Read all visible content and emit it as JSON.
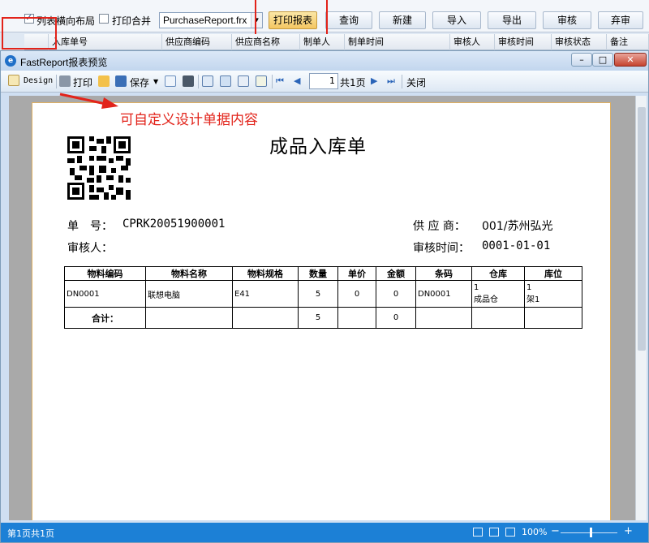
{
  "app_toolbar": {
    "checkbox_layout_label": "列表横向布局",
    "checkbox_layout_checked": true,
    "checkbox_merge_label": "打印合并",
    "checkbox_merge_checked": false,
    "report_file": "PurchaseReport.frx",
    "buttons": [
      "打印报表",
      "查询",
      "新建",
      "导入",
      "导出",
      "审核",
      "弃审"
    ]
  },
  "grid_columns": [
    "入库单号",
    "供应商编码",
    "供应商名称",
    "制单人",
    "制单时间",
    "审核人",
    "审核时间",
    "审核状态",
    "备注"
  ],
  "preview_window": {
    "title": "FastReport报表预览",
    "toolbar": {
      "design_label": "Design",
      "print_label": "打印",
      "save_label": "保存",
      "page_number": "1",
      "page_total": "共1页",
      "close_label": "关闭"
    },
    "annotation": "可自定义设计单据内容",
    "report": {
      "title": "成品入库单",
      "doc_no_label": "单　号：",
      "doc_no": "CPRK20051900001",
      "reviewer_label": "审核人：",
      "reviewer": "",
      "supplier_label": "供 应 商：",
      "supplier": "001/苏州弘光",
      "review_time_label": "审核时间：",
      "review_time": "0001-01-01",
      "table": {
        "headers": [
          "物料编码",
          "物料名称",
          "物料规格",
          "数量",
          "单价",
          "金额",
          "条码",
          "仓库",
          "库位"
        ],
        "rows": [
          {
            "code": "DN0001",
            "name": "联想电脑",
            "spec": "E41",
            "qty": "5",
            "price": "0",
            "amount": "0",
            "barcode": "DN0001",
            "warehouse_no": "1",
            "warehouse": "成品仓",
            "location_no": "1",
            "location": "架1"
          }
        ],
        "total": {
          "label": "合计：",
          "qty": "5",
          "amount": "0"
        }
      }
    },
    "status_bar": {
      "page_status": "第1页共1页",
      "zoom": "100%"
    }
  },
  "colors": {
    "annotation_red": "#e2231a",
    "status_bar_blue": "#1c80d6",
    "print_button_yellow": "#f4c662"
  }
}
